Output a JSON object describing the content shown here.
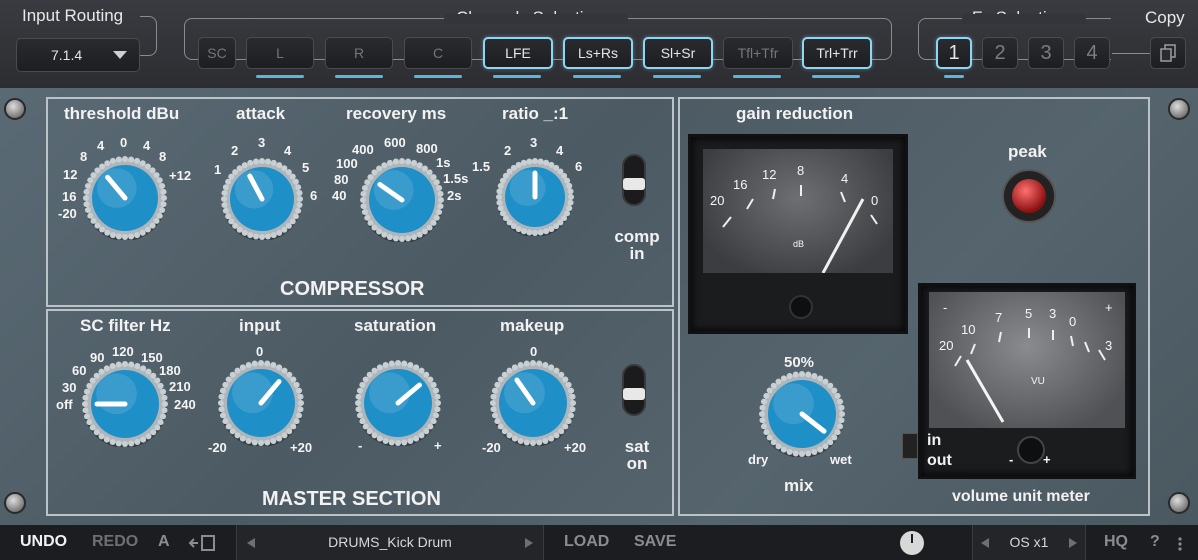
{
  "header": {
    "input_routing": {
      "label": "Input Routing",
      "value": "7.1.4"
    },
    "channels": {
      "label": "Channels Selection",
      "buttons": [
        "SC",
        "L",
        "R",
        "C",
        "LFE",
        "Ls+Rs",
        "Sl+Sr",
        "Tfl+Tfr",
        "Trl+Trr"
      ]
    },
    "fx": {
      "label": "Fx Selection",
      "buttons": [
        "1",
        "2",
        "3",
        "4"
      ]
    },
    "copy": {
      "label": "Copy"
    }
  },
  "compressor": {
    "title": "COMPRESSOR",
    "threshold": {
      "label": "threshold dBu",
      "ticks": [
        "-20",
        "16",
        "12",
        "8",
        "4",
        "0",
        "4",
        "8",
        "+12"
      ]
    },
    "attack": {
      "label": "attack",
      "ticks": [
        "1",
        "2",
        "3",
        "4",
        "5",
        "6"
      ]
    },
    "recovery": {
      "label": "recovery ms",
      "ticks": [
        "40",
        "80",
        "100",
        "400",
        "600",
        "800",
        "1s",
        "1.5s",
        "2s"
      ]
    },
    "ratio": {
      "label": "ratio _:1",
      "ticks": [
        "1.5",
        "2",
        "3",
        "4",
        "6"
      ]
    },
    "comp_in": {
      "label_1": "comp",
      "label_2": "in"
    }
  },
  "master": {
    "title": "MASTER SECTION",
    "sc_filter": {
      "label": "SC filter Hz",
      "ticks": [
        "off",
        "30",
        "60",
        "90",
        "120",
        "150",
        "180",
        "210",
        "240"
      ]
    },
    "input": {
      "label": "input",
      "ticks": [
        "0",
        "-20",
        "+20"
      ]
    },
    "saturation": {
      "label": "saturation",
      "ticks": [
        "-",
        "+"
      ]
    },
    "makeup": {
      "label": "makeup",
      "ticks": [
        "0",
        "-20",
        "+20"
      ]
    },
    "sat_on": {
      "label_1": "sat",
      "label_2": "on"
    }
  },
  "right": {
    "gain_reduction": {
      "label": "gain reduction",
      "scale": [
        "20",
        "16",
        "12",
        "8",
        "4",
        "0"
      ],
      "unit": "dB",
      "needle_value": 1.5
    },
    "peak": {
      "label": "peak"
    },
    "mix": {
      "label": "mix",
      "value": "50%",
      "dry": "dry",
      "wet": "wet"
    },
    "vu": {
      "label": "volume unit meter",
      "scale": [
        "-",
        "20",
        "10",
        "7",
        "5",
        "3",
        "0",
        "+",
        "3"
      ],
      "unit": "VU",
      "in_label": "in",
      "out_label": "out",
      "minus": "-",
      "plus": "+"
    }
  },
  "footer": {
    "undo": "UNDO",
    "redo": "REDO",
    "a": "A",
    "preset": "DRUMS_Kick Drum",
    "load": "LOAD",
    "save": "SAVE",
    "os": "OS x1",
    "hq": "HQ",
    "help": "?"
  },
  "colors": {
    "accent": "#8fd6f2",
    "knob": "#1f8fc7",
    "panel": "#52616a"
  }
}
